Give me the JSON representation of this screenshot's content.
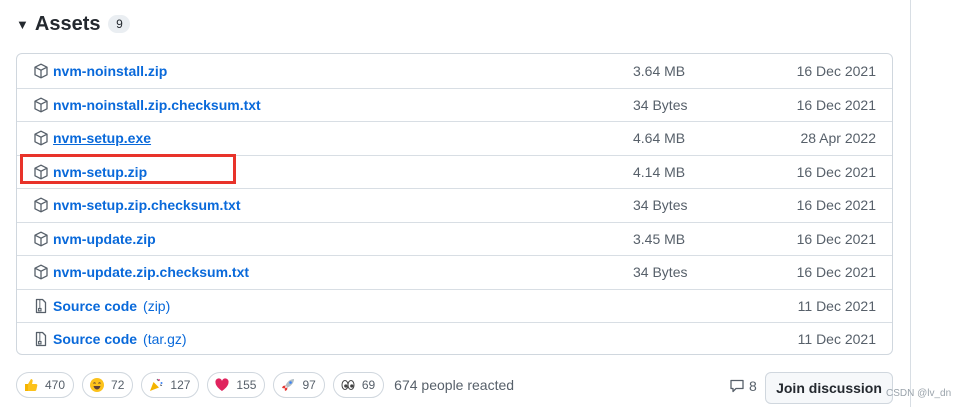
{
  "assets": {
    "title": "Assets",
    "count": "9",
    "rows": [
      {
        "icon": "package-icon",
        "name": "nvm-noinstall.zip",
        "suffix": "",
        "size": "3.64 MB",
        "date": "16 Dec 2021"
      },
      {
        "icon": "package-icon",
        "name": "nvm-noinstall.zip.checksum.txt",
        "suffix": "",
        "size": "34 Bytes",
        "date": "16 Dec 2021"
      },
      {
        "icon": "package-icon",
        "name": "nvm-setup.exe",
        "suffix": "",
        "size": "4.64 MB",
        "date": "28 Apr 2022"
      },
      {
        "icon": "package-icon",
        "name": "nvm-setup.zip",
        "suffix": "",
        "size": "4.14 MB",
        "date": "16 Dec 2021"
      },
      {
        "icon": "package-icon",
        "name": "nvm-setup.zip.checksum.txt",
        "suffix": "",
        "size": "34 Bytes",
        "date": "16 Dec 2021"
      },
      {
        "icon": "package-icon",
        "name": "nvm-update.zip",
        "suffix": "",
        "size": "3.45 MB",
        "date": "16 Dec 2021"
      },
      {
        "icon": "package-icon",
        "name": "nvm-update.zip.checksum.txt",
        "suffix": "",
        "size": "34 Bytes",
        "date": "16 Dec 2021"
      },
      {
        "icon": "file-zip-icon",
        "name": "Source code",
        "suffix": "(zip)",
        "size": "",
        "date": "11 Dec 2021"
      },
      {
        "icon": "file-zip-icon",
        "name": "Source code",
        "suffix": "(tar.gz)",
        "size": "",
        "date": "11 Dec 2021"
      }
    ]
  },
  "reactions": {
    "items": [
      {
        "name": "thumbs-up",
        "count": "470"
      },
      {
        "name": "laugh",
        "count": "72"
      },
      {
        "name": "hooray",
        "count": "127"
      },
      {
        "name": "heart",
        "count": "155"
      },
      {
        "name": "rocket",
        "count": "97"
      },
      {
        "name": "eyes",
        "count": "69"
      }
    ],
    "summary": "674 people reacted"
  },
  "discussion": {
    "comment_count": "8",
    "join_label": "Join discussion"
  },
  "watermark": "CSDN @lv_dn",
  "colors": {
    "link": "#0969da",
    "muted": "#57606a",
    "border": "#d0d7de",
    "highlight": "#e8332a"
  }
}
